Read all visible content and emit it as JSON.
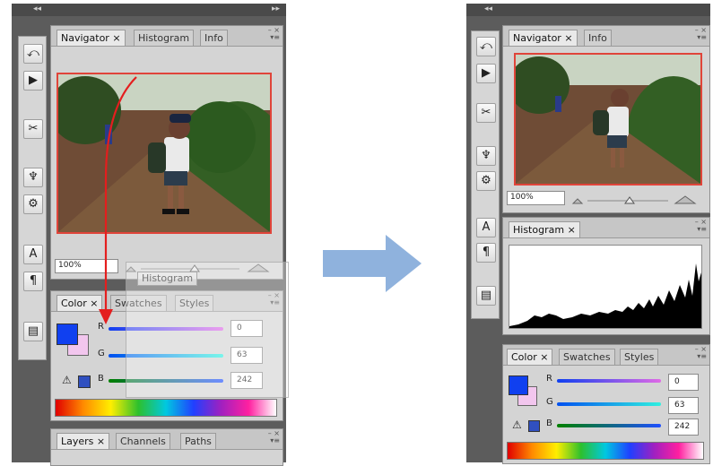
{
  "left": {
    "tabs": {
      "navigator": "Navigator",
      "histogram": "Histogram",
      "info": "Info"
    },
    "zoom_value": "100%",
    "drag_ghost_label": "Histogram",
    "color_tabs": {
      "color": "Color",
      "swatches": "Swatches",
      "styles": "Styles"
    },
    "channels": {
      "r_label": "R",
      "g_label": "G",
      "b_label": "B",
      "r_value": "0",
      "g_value": "63",
      "b_value": "242"
    },
    "layers_tabs": {
      "layers": "Layers",
      "channels": "Channels",
      "paths": "Paths"
    }
  },
  "right": {
    "tabs": {
      "navigator": "Navigator",
      "info": "Info"
    },
    "zoom_value": "100%",
    "histogram_tab": "Histogram",
    "color_tabs": {
      "color": "Color",
      "swatches": "Swatches",
      "styles": "Styles"
    },
    "channels": {
      "r_label": "R",
      "g_label": "G",
      "b_label": "B",
      "r_value": "0",
      "g_value": "63",
      "b_value": "242"
    }
  },
  "colors": {
    "foreground": "#1040f0",
    "background": "#f2c6ee",
    "drag_arrow": "#e41e1e",
    "transition_arrow": "#8fb2dd"
  },
  "icons": {
    "close": "×",
    "collapse": "◂◂",
    "expand": "▸▸",
    "warning": "⚠"
  }
}
